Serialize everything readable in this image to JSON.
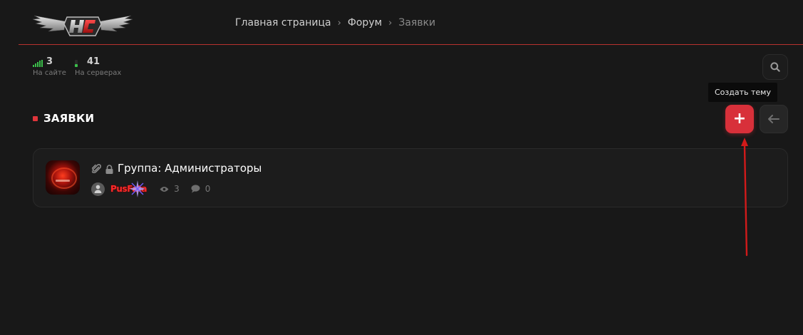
{
  "header": {
    "logo_text": "HC",
    "breadcrumb": {
      "home": "Главная страница",
      "forum": "Форум",
      "current": "Заявки",
      "separator": "›"
    }
  },
  "stats": {
    "online": {
      "value": "3",
      "label": "На сайте"
    },
    "servers": {
      "value": "41",
      "label": "На серверах"
    }
  },
  "search": {
    "icon": "search-icon"
  },
  "tooltip": {
    "text": "Создать тему"
  },
  "section": {
    "title": "ЗАЯВКИ"
  },
  "actions": {
    "create_label": "+",
    "back_icon": "arrow-left-icon"
  },
  "topics": [
    {
      "title": "Группа: Администраторы",
      "author": "PusFata",
      "views": "3",
      "replies": "0"
    }
  ],
  "colors": {
    "accent": "#d8303a",
    "background": "#181818",
    "card": "#1c1c1c",
    "online_green": "#3bbf4a",
    "annotation_arrow": "#d11a1a"
  }
}
